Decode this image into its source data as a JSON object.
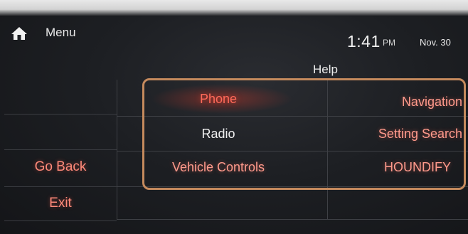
{
  "header": {
    "menu_label": "Menu",
    "time": "1:41",
    "ampm": "PM",
    "date": "Nov. 30",
    "title": "Help"
  },
  "left_menu": {
    "go_back": "Go Back",
    "exit": "Exit"
  },
  "help_items": [
    {
      "label": "Phone"
    },
    {
      "label": "Navigation"
    },
    {
      "label": "Radio"
    },
    {
      "label": "Setting Search"
    },
    {
      "label": "Vehicle Controls"
    },
    {
      "label": "HOUNDIFY"
    }
  ],
  "colors": {
    "highlight_border": "#c58a5d",
    "accent_red": "#ff6a5a"
  },
  "icons": {
    "home": "home-icon"
  }
}
